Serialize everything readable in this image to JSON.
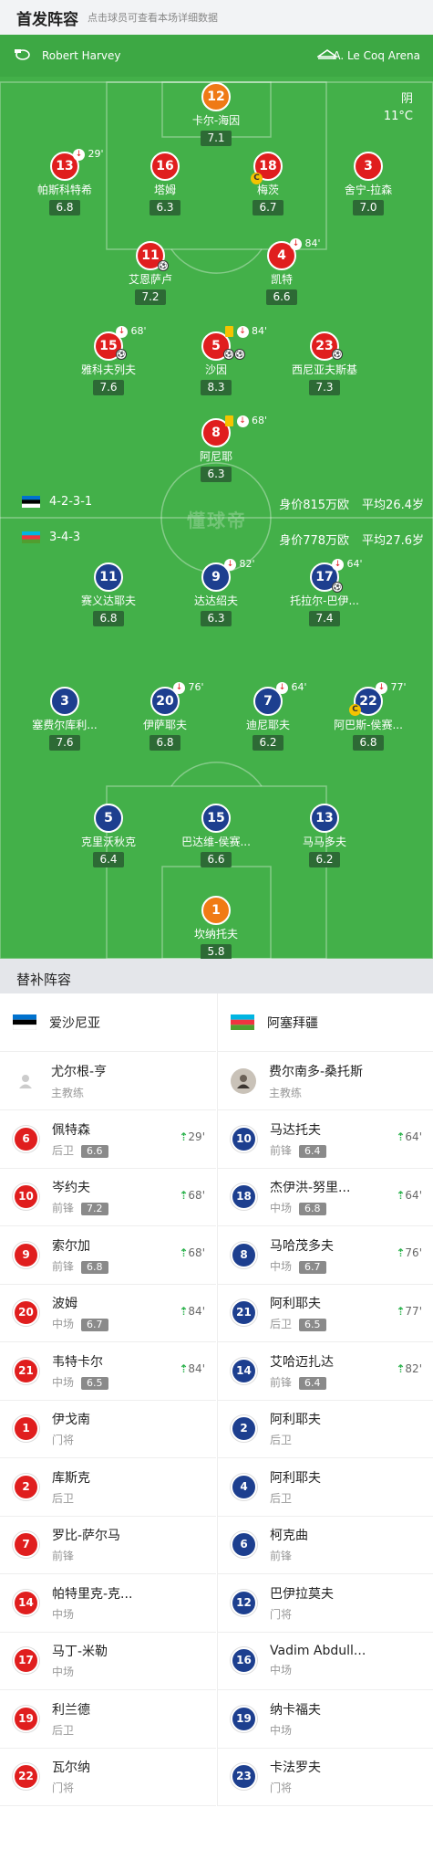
{
  "header": {
    "title": "首发阵容",
    "hint": "点击球员可查看本场详细数据"
  },
  "match_info": {
    "referee": "Robert Harvey",
    "venue": "A. Le Coq Arena",
    "weather": "阴",
    "temperature": "11°C"
  },
  "watermark": "懂球帝",
  "home_team": {
    "formation": "4-2-3-1",
    "value": "身价815万欧",
    "avg_age": "平均26.4岁"
  },
  "away_team": {
    "formation": "3-4-3",
    "value": "身价778万欧",
    "avg_age": "平均27.6岁"
  },
  "home_players": [
    {
      "num": "12",
      "name": "卡尔-海因",
      "rating": "7.1"
    },
    {
      "num": "13",
      "name": "帕斯科特希",
      "rating": "6.8",
      "event": "29'"
    },
    {
      "num": "16",
      "name": "塔姆",
      "rating": "6.3"
    },
    {
      "num": "18",
      "name": "梅茨",
      "rating": "6.7"
    },
    {
      "num": "3",
      "name": "舍宁-拉森",
      "rating": "7.0"
    },
    {
      "num": "11",
      "name": "艾恩萨卢",
      "rating": "7.2"
    },
    {
      "num": "4",
      "name": "凯特",
      "rating": "6.6",
      "event": "84'"
    },
    {
      "num": "15",
      "name": "雅科夫列夫",
      "rating": "7.6",
      "event": "68'"
    },
    {
      "num": "5",
      "name": "沙因",
      "rating": "8.3",
      "event": "84'"
    },
    {
      "num": "23",
      "name": "西尼亚夫斯基",
      "rating": "7.3"
    },
    {
      "num": "8",
      "name": "阿尼耶",
      "rating": "6.3",
      "event": "68'"
    }
  ],
  "away_players": [
    {
      "num": "11",
      "name": "赛义达耶夫",
      "rating": "6.8"
    },
    {
      "num": "9",
      "name": "达达绍夫",
      "rating": "6.3",
      "event": "82'"
    },
    {
      "num": "17",
      "name": "托拉尔-巴伊...",
      "rating": "7.4",
      "event": "64'"
    },
    {
      "num": "3",
      "name": "塞费尔库利...",
      "rating": "7.6"
    },
    {
      "num": "20",
      "name": "伊萨耶夫",
      "rating": "6.8",
      "event": "76'"
    },
    {
      "num": "7",
      "name": "迪尼耶夫",
      "rating": "6.2",
      "event": "64'"
    },
    {
      "num": "22",
      "name": "阿巴斯-侯赛...",
      "rating": "6.8",
      "event": "77'"
    },
    {
      "num": "5",
      "name": "克里沃秋克",
      "rating": "6.4"
    },
    {
      "num": "15",
      "name": "巴达维-侯赛...",
      "rating": "6.6"
    },
    {
      "num": "13",
      "name": "马马多夫",
      "rating": "6.2"
    },
    {
      "num": "1",
      "name": "坎纳托夫",
      "rating": "5.8"
    }
  ],
  "subs_title": "替补阵容",
  "home_subs": {
    "team_name": "爱沙尼亚",
    "coach_name": "尤尔根-亨",
    "coach_role": "主教练",
    "players": [
      {
        "num": "6",
        "name": "佩特森",
        "pos": "后卫",
        "rating": "6.6",
        "min": "29'"
      },
      {
        "num": "10",
        "name": "岑约夫",
        "pos": "前锋",
        "rating": "7.2",
        "min": "68'"
      },
      {
        "num": "9",
        "name": "索尔加",
        "pos": "前锋",
        "rating": "6.8",
        "min": "68'"
      },
      {
        "num": "20",
        "name": "波姆",
        "pos": "中场",
        "rating": "6.7",
        "min": "84'"
      },
      {
        "num": "21",
        "name": "韦特卡尔",
        "pos": "中场",
        "rating": "6.5",
        "min": "84'"
      },
      {
        "num": "1",
        "name": "伊戈南",
        "pos": "门将"
      },
      {
        "num": "2",
        "name": "库斯克",
        "pos": "后卫"
      },
      {
        "num": "7",
        "name": "罗比-萨尔马",
        "pos": "前锋"
      },
      {
        "num": "14",
        "name": "帕特里克-克...",
        "pos": "中场"
      },
      {
        "num": "17",
        "name": "马丁-米勒",
        "pos": "中场"
      },
      {
        "num": "19",
        "name": "利兰德",
        "pos": "后卫"
      },
      {
        "num": "22",
        "name": "瓦尔纳",
        "pos": "门将"
      }
    ]
  },
  "away_subs": {
    "team_name": "阿塞拜疆",
    "coach_name": "费尔南多-桑托斯",
    "coach_role": "主教练",
    "players": [
      {
        "num": "10",
        "name": "马达托夫",
        "pos": "前锋",
        "rating": "6.4",
        "min": "64'"
      },
      {
        "num": "18",
        "name": "杰伊洪-努里...",
        "pos": "中场",
        "rating": "6.8",
        "min": "64'"
      },
      {
        "num": "8",
        "name": "马哈茂多夫",
        "pos": "中场",
        "rating": "6.7",
        "min": "76'"
      },
      {
        "num": "21",
        "name": "阿利耶夫",
        "pos": "后卫",
        "rating": "6.5",
        "min": "77'"
      },
      {
        "num": "14",
        "name": "艾哈迈扎达",
        "pos": "前锋",
        "rating": "6.4",
        "min": "82'"
      },
      {
        "num": "2",
        "name": "阿利耶夫",
        "pos": "后卫"
      },
      {
        "num": "4",
        "name": "阿利耶夫",
        "pos": "后卫"
      },
      {
        "num": "6",
        "name": "柯克曲",
        "pos": "前锋"
      },
      {
        "num": "12",
        "name": "巴伊拉莫夫",
        "pos": "门将"
      },
      {
        "num": "16",
        "name": "Vadim Abdull...",
        "pos": "中场"
      },
      {
        "num": "19",
        "name": "纳卡福夫",
        "pos": "中场"
      },
      {
        "num": "23",
        "name": "卡法罗夫",
        "pos": "门将"
      }
    ]
  },
  "colors": {
    "pitch": "#43b049",
    "home": "#e01e1e",
    "away": "#1d3f8f",
    "goalkeeper": "#ef7a16"
  }
}
